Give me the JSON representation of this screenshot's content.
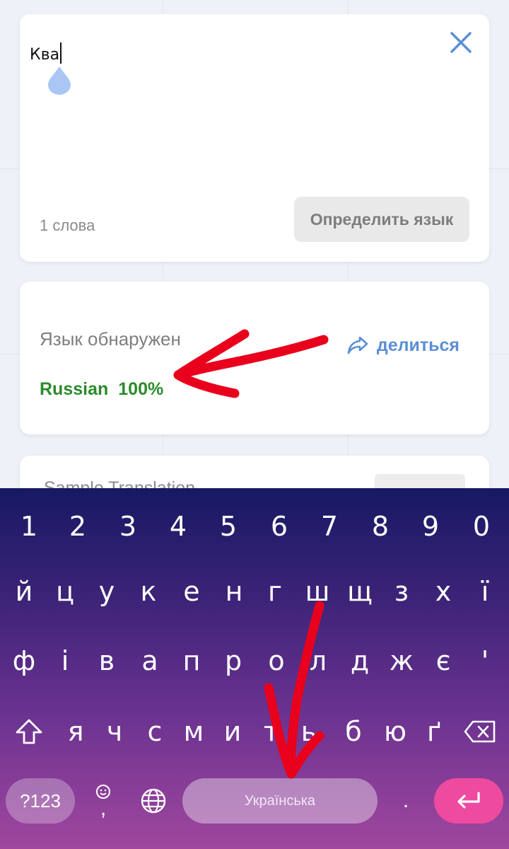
{
  "input_card": {
    "text": "Ква",
    "word_count": "1 слова",
    "detect_button": "Определить язык"
  },
  "result_card": {
    "detected_label": "Язык обнаружен",
    "share_label": "делиться",
    "language": "Russian",
    "confidence": "100%"
  },
  "sample_card": {
    "title": "Sample Translation"
  },
  "keyboard": {
    "number_row": [
      "1",
      "2",
      "3",
      "4",
      "5",
      "6",
      "7",
      "8",
      "9",
      "0"
    ],
    "row1": [
      "й",
      "ц",
      "у",
      "к",
      "е",
      "н",
      "г",
      "ш",
      "щ",
      "з",
      "х",
      "ї"
    ],
    "row2": [
      "ф",
      "і",
      "в",
      "а",
      "п",
      "р",
      "о",
      "л",
      "д",
      "ж",
      "є",
      "'"
    ],
    "row3": [
      "я",
      "ч",
      "с",
      "м",
      "и",
      "т",
      "ь",
      "б",
      "ю",
      "ґ"
    ],
    "symbols_key": "?123",
    "comma_key": ",",
    "period_key": ".",
    "space_label": "Українська",
    "icons": [
      "shift-icon",
      "backspace-icon",
      "emoji-icon",
      "globe-icon",
      "enter-icon"
    ]
  },
  "colors": {
    "accent_blue": "#5b8fd6",
    "detected_green": "#2c8a2c",
    "annotation_red": "#e8001c",
    "enter_pink": "#ee4aa0"
  }
}
